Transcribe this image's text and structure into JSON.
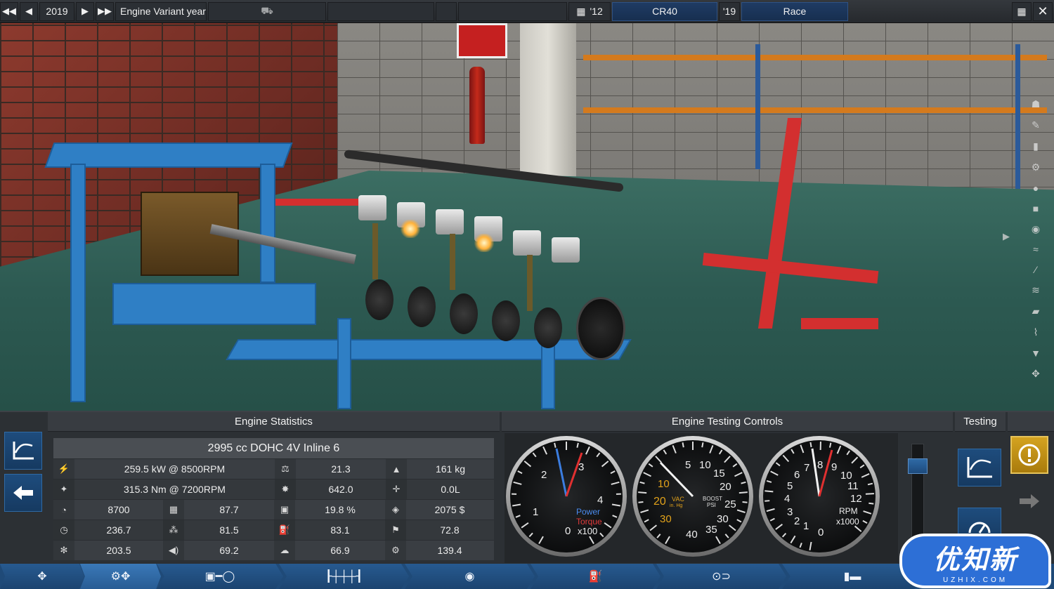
{
  "topbar": {
    "year": "2019",
    "variant_label": "Engine Variant year",
    "year_start": "'12",
    "model_code": "CR40",
    "year_end": "'19",
    "mode": "Race"
  },
  "panels": {
    "engine_statistics_title": "Engine Statistics",
    "engine_testing_title": "Engine Testing Controls",
    "testing_title": "Testing"
  },
  "engine": {
    "summary": "2995 cc DOHC 4V  Inline 6",
    "rows": [
      [
        "259.5 kW @ 8500RPM",
        "21.3",
        "161 kg"
      ],
      [
        "315.3 Nm @ 7200RPM",
        "642.0",
        "0.0L"
      ],
      [
        "8700",
        "87.7",
        "19.8 %",
        "2075 $"
      ],
      [
        "236.7",
        "81.5",
        "83.1",
        "72.8"
      ],
      [
        "203.5",
        "69.2",
        "66.9",
        "139.4"
      ]
    ]
  },
  "gauges": {
    "power_torque": {
      "labels": [
        "1",
        "2",
        "3",
        "4"
      ],
      "zero": "0",
      "unit": "x100",
      "power_label": "Power",
      "torque_label": "Torque"
    },
    "boost": {
      "labels": [
        "5",
        "10",
        "15",
        "20",
        "25",
        "30",
        "35",
        "40"
      ],
      "vac": [
        "10",
        "20",
        "30"
      ],
      "vac_label": "VAC",
      "vac_unit": "in. Hg",
      "boost_label": "BOOST",
      "boost_unit": "PSI"
    },
    "rpm": {
      "labels": [
        "0",
        "1",
        "2",
        "3",
        "4",
        "5",
        "6",
        "7",
        "8",
        "9",
        "10",
        "11",
        "12"
      ],
      "unit_label": "RPM",
      "unit_mult": "x1000"
    }
  },
  "watermark": {
    "main": "优知新",
    "sub": "UZHIX.COM"
  },
  "colors": {
    "accent_blue": "#1f4a78",
    "warn_yellow": "#d4a320",
    "power_needle": "#3b7de0",
    "torque_needle": "#e03030"
  }
}
